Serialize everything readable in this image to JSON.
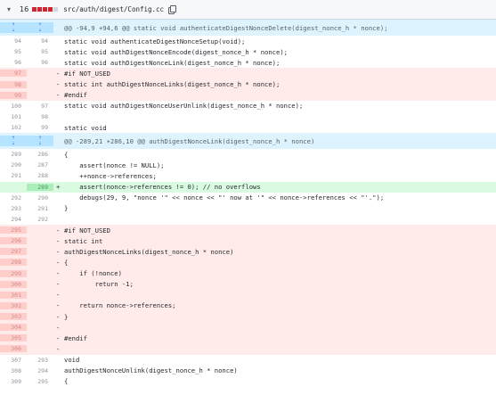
{
  "file": {
    "chevron": "▾",
    "change_count": "16",
    "path": "src/auth/digest/Config.cc"
  },
  "hunk1": {
    "header": "@@ -94,9 +94,6 @@ static void authenticateDigestNonceDelete(digest_nonce_h * nonce);"
  },
  "lines1": [
    {
      "type": "ctx",
      "old": "94",
      "new": "94",
      "sign": "",
      "text": "static void authenticateDigestNonceSetup(void);"
    },
    {
      "type": "ctx",
      "old": "95",
      "new": "95",
      "sign": "",
      "text": "static void authDigestNonceEncode(digest_nonce_h * nonce);"
    },
    {
      "type": "ctx",
      "old": "96",
      "new": "96",
      "sign": "",
      "text": "static void authDigestNonceLink(digest_nonce_h * nonce);"
    },
    {
      "type": "del",
      "old": "97",
      "new": "",
      "sign": "-",
      "text": "#if NOT_USED"
    },
    {
      "type": "del",
      "old": "98",
      "new": "",
      "sign": "-",
      "text": "static int authDigestNonceLinks(digest_nonce_h * nonce);"
    },
    {
      "type": "del",
      "old": "99",
      "new": "",
      "sign": "-",
      "text": "#endif"
    },
    {
      "type": "ctx",
      "old": "100",
      "new": "97",
      "sign": "",
      "text": "static void authDigestNonceUserUnlink(digest_nonce_h * nonce);"
    },
    {
      "type": "ctx",
      "old": "101",
      "new": "98",
      "sign": "",
      "text": ""
    },
    {
      "type": "ctx",
      "old": "102",
      "new": "99",
      "sign": "",
      "text": "static void"
    }
  ],
  "hunk2": {
    "header": "@@ -289,21 +286,10 @@ authDigestNonceLink(digest_nonce_h * nonce)"
  },
  "lines2": [
    {
      "type": "ctx",
      "old": "289",
      "new": "286",
      "sign": "",
      "text": "{"
    },
    {
      "type": "ctx",
      "old": "290",
      "new": "287",
      "sign": "",
      "text": "    assert(nonce != NULL);"
    },
    {
      "type": "ctx",
      "old": "291",
      "new": "288",
      "sign": "",
      "text": "    ++nonce->references;"
    },
    {
      "type": "add",
      "old": "",
      "new": "289",
      "sign": "+",
      "text": "    assert(nonce->references != 0); // no overflows"
    },
    {
      "type": "ctx",
      "old": "292",
      "new": "290",
      "sign": "",
      "text": "    debugs(29, 9, \"nonce '\" << nonce << \"' now at '\" << nonce->references << \"'.\");"
    },
    {
      "type": "ctx",
      "old": "293",
      "new": "291",
      "sign": "",
      "text": "}"
    },
    {
      "type": "ctx",
      "old": "294",
      "new": "292",
      "sign": "",
      "text": ""
    },
    {
      "type": "del",
      "old": "295",
      "new": "",
      "sign": "-",
      "text": "#if NOT_USED"
    },
    {
      "type": "del",
      "old": "296",
      "new": "",
      "sign": "-",
      "text": "static int"
    },
    {
      "type": "del",
      "old": "297",
      "new": "",
      "sign": "-",
      "text": "authDigestNonceLinks(digest_nonce_h * nonce)"
    },
    {
      "type": "del",
      "old": "298",
      "new": "",
      "sign": "-",
      "text": "{"
    },
    {
      "type": "del",
      "old": "299",
      "new": "",
      "sign": "-",
      "text": "    if (!nonce)"
    },
    {
      "type": "del",
      "old": "300",
      "new": "",
      "sign": "-",
      "text": "        return -1;"
    },
    {
      "type": "del",
      "old": "301",
      "new": "",
      "sign": "-",
      "text": ""
    },
    {
      "type": "del",
      "old": "302",
      "new": "",
      "sign": "-",
      "text": "    return nonce->references;"
    },
    {
      "type": "del",
      "old": "303",
      "new": "",
      "sign": "-",
      "text": "}"
    },
    {
      "type": "del",
      "old": "304",
      "new": "",
      "sign": "-",
      "text": ""
    },
    {
      "type": "del",
      "old": "305",
      "new": "",
      "sign": "-",
      "text": "#endif"
    },
    {
      "type": "del",
      "old": "306",
      "new": "",
      "sign": "-",
      "text": ""
    },
    {
      "type": "ctx",
      "old": "307",
      "new": "293",
      "sign": "",
      "text": "void"
    },
    {
      "type": "ctx",
      "old": "308",
      "new": "294",
      "sign": "",
      "text": "authDigestNonceUnlink(digest_nonce_h * nonce)"
    },
    {
      "type": "ctx",
      "old": "309",
      "new": "295",
      "sign": "",
      "text": "{"
    }
  ]
}
